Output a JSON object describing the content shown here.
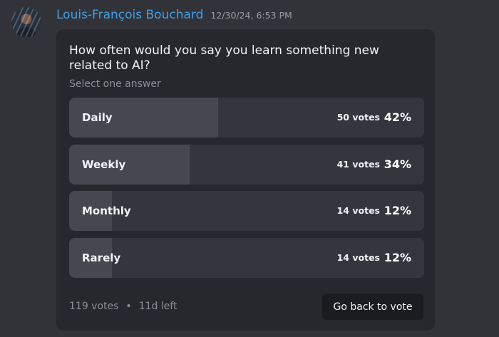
{
  "message": {
    "author": "Louis-François Bouchard",
    "timestamp": "12/30/24, 6:53 PM",
    "author_color": "#3ea1e8"
  },
  "poll": {
    "question": "How often would you say you learn something new related to AI?",
    "instruction": "Select one answer",
    "options": [
      {
        "label": "Daily",
        "votes": "50 votes",
        "percent": "42%",
        "fraction": 0.42
      },
      {
        "label": "Weekly",
        "votes": "41 votes",
        "percent": "34%",
        "fraction": 0.34
      },
      {
        "label": "Monthly",
        "votes": "14 votes",
        "percent": "12%",
        "fraction": 0.12
      },
      {
        "label": "Rarely",
        "votes": "14 votes",
        "percent": "12%",
        "fraction": 0.12
      }
    ],
    "total_votes": "119 votes",
    "separator": "•",
    "time_left": "11d left",
    "vote_button_label": "Go back to vote"
  }
}
